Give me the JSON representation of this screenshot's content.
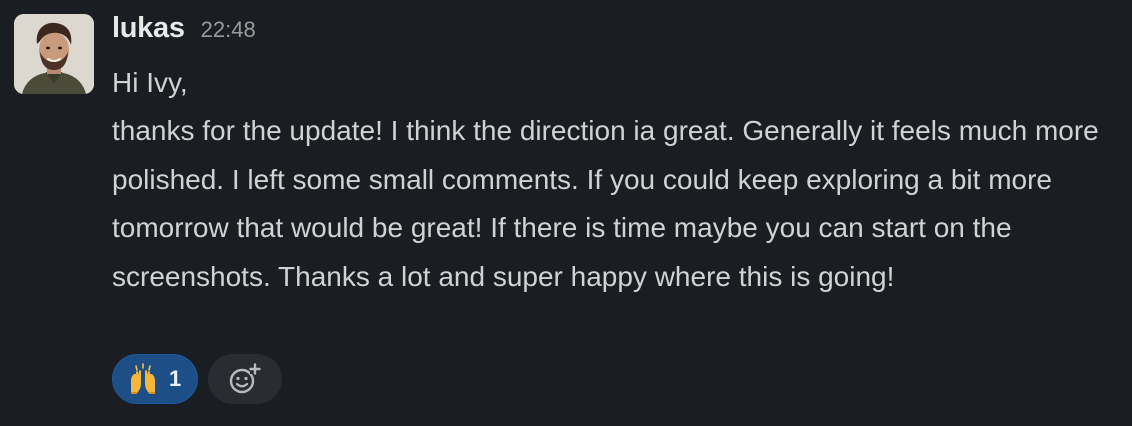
{
  "message": {
    "author": "lukas",
    "timestamp": "22:48",
    "greeting": "Hi Ivy,",
    "text": "thanks for the update! I think the direction ia great. Generally it feels much more polished. I left some small comments. If you could keep exploring a bit more tomorrow that would be great! If there is time maybe you can start on the screenshots. Thanks a lot and super happy where this is going!"
  },
  "reactions": [
    {
      "emoji_name": "raised-hands-icon",
      "emoji": "🙌",
      "count": "1",
      "active": true
    }
  ],
  "add_reaction": {
    "icon": "add-reaction-icon"
  },
  "colors": {
    "background": "#1a1d21",
    "text": "#d1d2d3",
    "author": "#e8e8e8",
    "timestamp": "#9a9b9d",
    "reaction_active_bg": "#1d4f86",
    "add_reaction_bg": "#2a2c31"
  }
}
